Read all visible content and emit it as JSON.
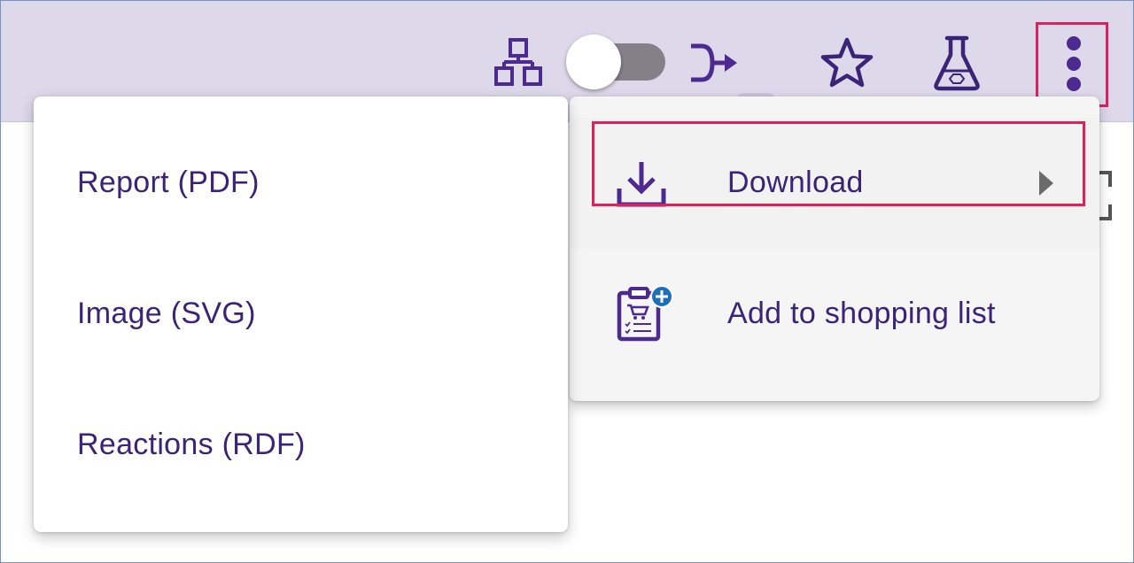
{
  "toolbar": {
    "icons": {
      "layout": "hierarchy-icon",
      "toggle": "toggle-switch",
      "route": "route-arrow-icon",
      "favorite": "star-icon",
      "flask": "flask-icon",
      "more": "more-vertical-icon"
    },
    "toggle_state": "off"
  },
  "main_menu": {
    "items": [
      {
        "label": "Download",
        "icon": "download-icon",
        "has_submenu": true
      },
      {
        "label": "Add to shopping list",
        "icon": "shopping-list-add-icon",
        "has_submenu": false
      }
    ]
  },
  "download_submenu": {
    "items": [
      {
        "label": "Report (PDF)"
      },
      {
        "label": "Image (SVG)"
      },
      {
        "label": "Reactions (RDF)"
      }
    ]
  },
  "colors": {
    "toolbar_bg": "#ddd8ea",
    "accent_purple": "#3b2377",
    "icon_purple": "#4d2a8f",
    "highlight": "#e0205c",
    "badge_blue": "#1d6fb8"
  }
}
